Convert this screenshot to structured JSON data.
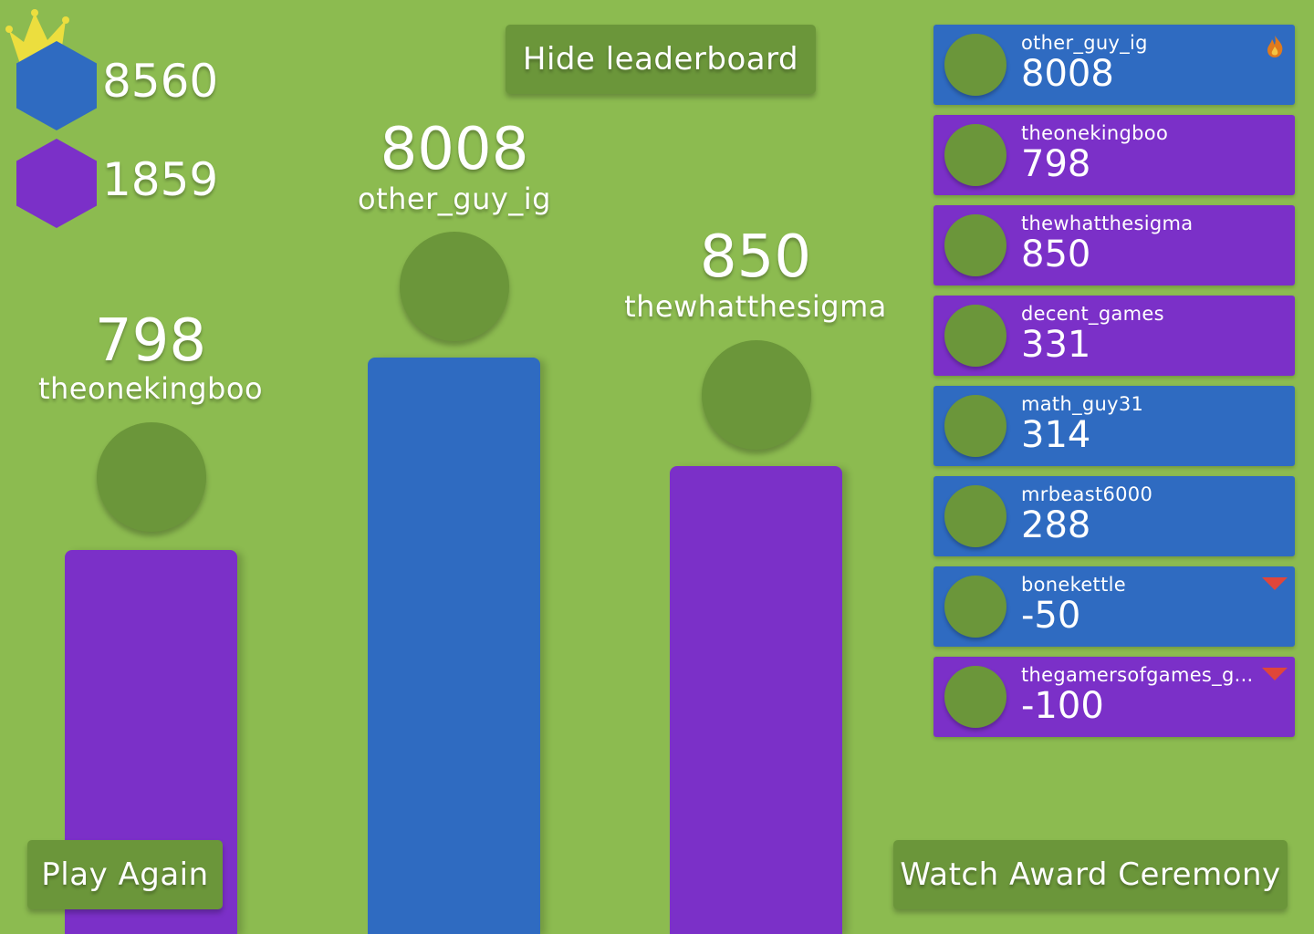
{
  "colors": {
    "background": "#8cbb50",
    "button": "#6b963a",
    "avatar": "#6b963a",
    "team_blue": "#2f6bc1",
    "team_purple": "#7b30c8",
    "crown": "#ecde3e",
    "down_arrow": "#e0463a",
    "flame": "#e07a1c"
  },
  "teams": {
    "blue": {
      "score": "8560",
      "icon": "blue-hexagon-icon",
      "has_crown": true
    },
    "purple": {
      "score": "1859",
      "icon": "purple-hexagon-icon"
    }
  },
  "buttons": {
    "hide_leaderboard": "Hide leaderboard",
    "play_again": "Play Again",
    "award_ceremony": "Watch Award Ceremony"
  },
  "podium": [
    {
      "place": 2,
      "name": "theonekingboo",
      "score": "798",
      "team": "purple"
    },
    {
      "place": 1,
      "name": "other_guy_ig",
      "score": "8008",
      "team": "blue"
    },
    {
      "place": 3,
      "name": "thewhatthesigma",
      "score": "850",
      "team": "purple"
    }
  ],
  "leaderboard": [
    {
      "name": "other_guy_ig",
      "score": "8008",
      "team": "blue",
      "icon": "flame-icon"
    },
    {
      "name": "theonekingboo",
      "score": "798",
      "team": "purple",
      "icon": ""
    },
    {
      "name": "thewhatthesigma",
      "score": "850",
      "team": "purple",
      "icon": ""
    },
    {
      "name": "decent_games",
      "score": "331",
      "team": "purple",
      "icon": ""
    },
    {
      "name": "math_guy31",
      "score": "314",
      "team": "blue",
      "icon": ""
    },
    {
      "name": "mrbeast6000",
      "score": "288",
      "team": "blue",
      "icon": ""
    },
    {
      "name": "bonekettle",
      "score": "-50",
      "team": "blue",
      "icon": "down-arrow-icon"
    },
    {
      "name": "thegamersofgames_g...",
      "score": "-100",
      "team": "purple",
      "icon": "down-arrow-icon"
    }
  ]
}
